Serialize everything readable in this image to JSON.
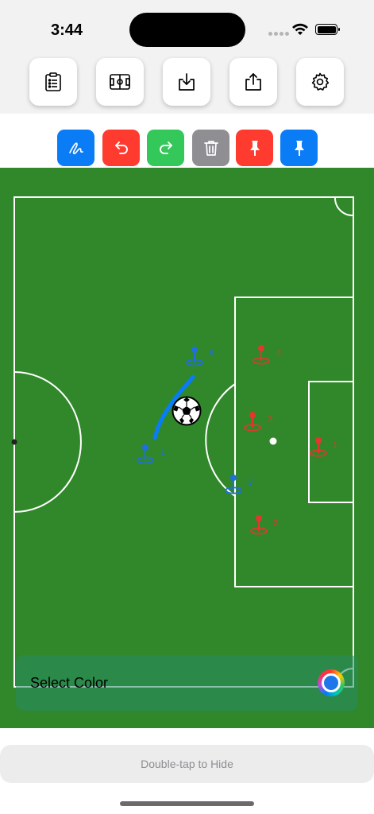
{
  "status_bar": {
    "time": "3:44"
  },
  "toolbar": {
    "buttons": [
      {
        "id": "lineup",
        "icon": "clipboard-list-icon"
      },
      {
        "id": "field",
        "icon": "soccer-field-icon"
      },
      {
        "id": "save",
        "icon": "download-icon"
      },
      {
        "id": "share",
        "icon": "share-icon"
      },
      {
        "id": "settings",
        "icon": "gear-icon"
      }
    ]
  },
  "draw_toolbar": {
    "buttons": [
      {
        "id": "draw",
        "icon": "scribble-icon",
        "color": "#0a7cf5"
      },
      {
        "id": "undo",
        "icon": "undo-arrow-icon",
        "color": "#ff3b30"
      },
      {
        "id": "redo",
        "icon": "redo-arrow-icon",
        "color": "#34c759"
      },
      {
        "id": "clear",
        "icon": "trash-icon",
        "color": "#8e8e93"
      },
      {
        "id": "red-pin",
        "icon": "pin-icon",
        "color": "#ff3b30"
      },
      {
        "id": "blue-pin",
        "icon": "pin-icon",
        "color": "#0a7cf5"
      }
    ]
  },
  "field": {
    "grass_color": "#30882a",
    "red_markers": [
      {
        "label": "4"
      },
      {
        "label": "3"
      },
      {
        "label": "1"
      },
      {
        "label": "2"
      }
    ],
    "blue_markers": [
      {
        "label": "5"
      },
      {
        "label": "1"
      },
      {
        "label": "3"
      }
    ]
  },
  "color_panel": {
    "label": "Select Color",
    "selected_color": "#1f76e8"
  },
  "hide_bar": {
    "text": "Double-tap to Hide"
  },
  "colors": {
    "red_team": "#e0392b",
    "blue_team": "#1f6fe0",
    "drawing_stroke": "#0a7cf5"
  }
}
